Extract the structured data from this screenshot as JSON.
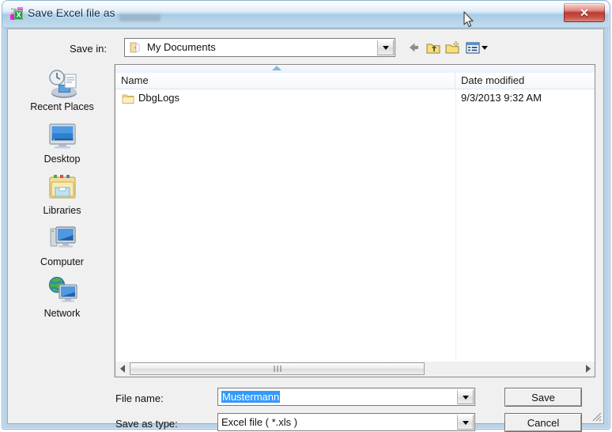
{
  "window": {
    "title": "Save Excel file as",
    "icon": "pdf-to-excel-icon",
    "close_label": "✕"
  },
  "toolbar": {
    "save_in_label": "Save in:",
    "save_in_value": "My Documents",
    "save_in_icon": "folder-open-icon",
    "buttons": [
      {
        "name": "back-button",
        "icon": "back-arrow-icon"
      },
      {
        "name": "up-one-level-button",
        "icon": "up-folder-icon"
      },
      {
        "name": "new-folder-button",
        "icon": "new-folder-icon"
      },
      {
        "name": "views-button",
        "icon": "views-icon"
      }
    ]
  },
  "places": {
    "items": [
      {
        "label": "Recent Places",
        "icon": "recent-places-icon"
      },
      {
        "label": "Desktop",
        "icon": "desktop-icon"
      },
      {
        "label": "Libraries",
        "icon": "libraries-icon"
      },
      {
        "label": "Computer",
        "icon": "computer-icon"
      },
      {
        "label": "Network",
        "icon": "network-icon"
      }
    ]
  },
  "filelist": {
    "columns": [
      "Name",
      "Date modified"
    ],
    "sort_column": "Name",
    "sort_direction": "ascending",
    "rows": [
      {
        "name": "DbgLogs",
        "date_modified": "9/3/2013 9:32 AM",
        "icon": "folder-icon"
      }
    ]
  },
  "fields": {
    "file_name_label": "File name:",
    "file_name_value": "Mustermann",
    "save_as_type_label": "Save as type:",
    "save_as_type_value": "Excel file ( *.xls )"
  },
  "buttons": {
    "save_label": "Save",
    "cancel_label": "Cancel"
  },
  "colors": {
    "selection_blue": "#3399ff",
    "close_red": "#b8372c",
    "title_blue": "#0b2a47",
    "dialog_face": "#f0f0f0"
  }
}
